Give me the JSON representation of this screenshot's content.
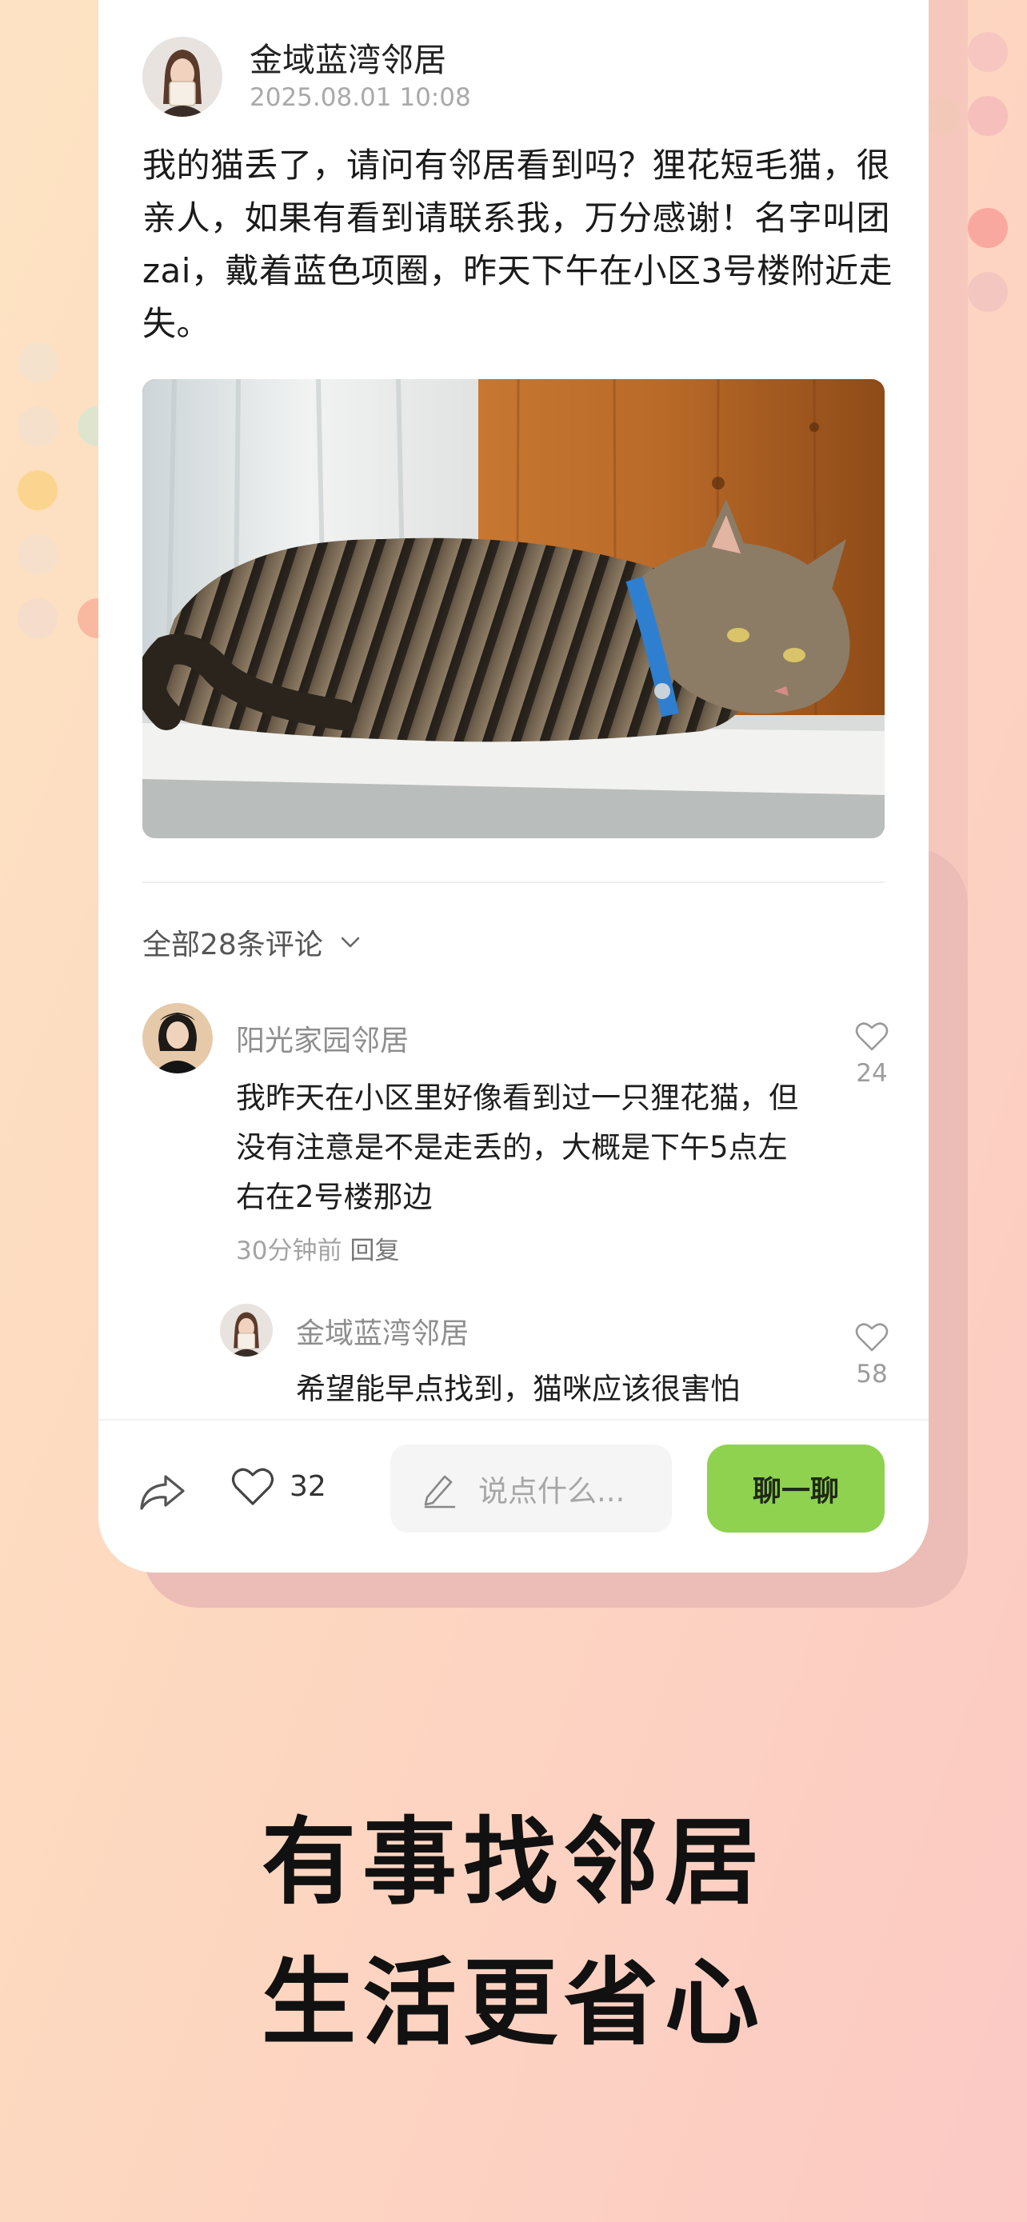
{
  "post": {
    "author": "金域蓝湾邻居",
    "time": "2025.08.01 10:08",
    "text": "我的猫丢了，请问有邻居看到吗？狸花短毛猫，很亲人，如果有看到请联系我，万分感谢！名字叫团zai，戴着蓝色项圈，昨天下午在小区3号楼附近走失。"
  },
  "comments_header": "全部28条评论",
  "comments": [
    {
      "name": "阳光家园邻居",
      "text": "我昨天在小区里好像看到过一只狸花猫，但没有注意是不是走丢的，大概是下午5点左右在2号楼那边",
      "time": "30分钟前",
      "reply_label": "回复",
      "likes": "24"
    },
    {
      "name": "金域蓝湾邻居",
      "text": "希望能早点找到，猫咪应该很害怕",
      "likes": "58"
    }
  ],
  "bottom_bar": {
    "like_count": "32",
    "input_placeholder": "说点什么...",
    "chat_label": "聊一聊"
  },
  "slogan": {
    "line1": "有事找邻居",
    "line2": "生活更省心"
  },
  "colors": {
    "accent_green": "#8ed24f",
    "background_from": "#fde3c3",
    "background_to": "#fcc9c4"
  },
  "icons": {
    "share": "share-icon",
    "like": "heart-icon",
    "edit": "pencil-icon",
    "expand": "chevron-down-icon"
  }
}
